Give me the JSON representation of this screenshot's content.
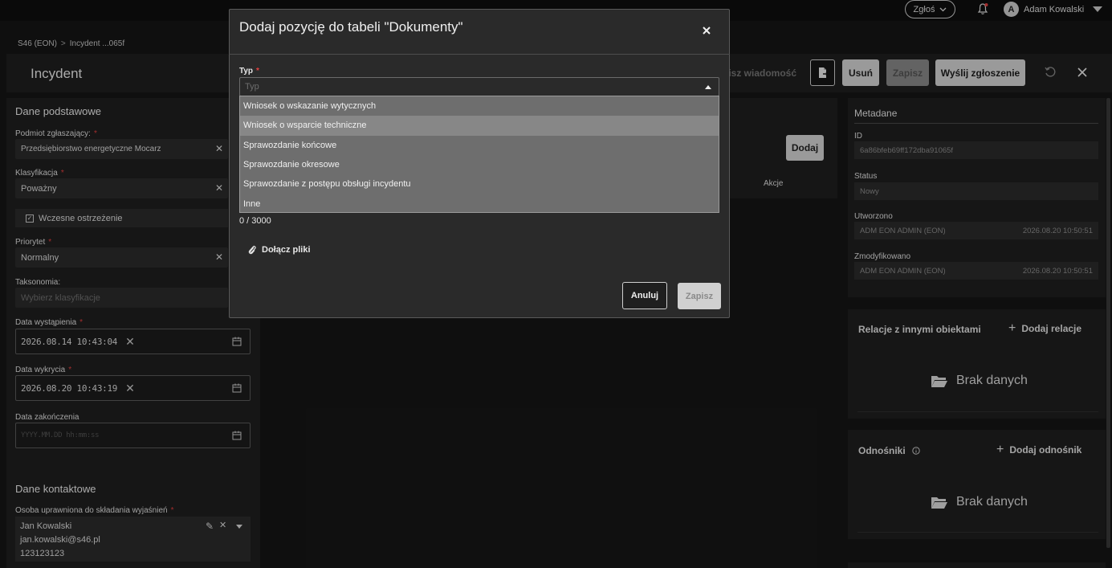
{
  "topbar": {
    "report_button": "Zgłoś",
    "user_initial": "A",
    "user_name": "Adam Kowalski"
  },
  "breadcrumb": {
    "root": "S46 (EON)",
    "separator": ">",
    "current": "Incydent ...065f"
  },
  "header": {
    "title": "Incydent",
    "partial_action": "pisz wiadomość",
    "delete_label": "Usuń",
    "save_label": "Zapisz",
    "send_label": "Wyślij zgłoszenie"
  },
  "basic": {
    "section_title": "Dane podstawowe",
    "reporter_label": "Podmiot zgłaszający:",
    "reporter_value": "Przedsiębiorstwo energetyczne Mocarz",
    "classification_label": "Klasyfikacja",
    "classification_value": "Poważny",
    "early_warning_label": "Wczesne ostrzeżenie",
    "priority_label": "Priorytet",
    "priority_value": "Normalny",
    "taxonomy_label": "Taksonomia:",
    "taxonomy_placeholder": "Wybierz klasyfikacje",
    "occurrence_label": "Data wystąpienia",
    "occurrence_value": "2026.08.14 10:43:04",
    "detection_label": "Data wykrycia",
    "detection_value": "2026.08.20 10:43:19",
    "end_label": "Data zakończenia",
    "end_placeholder": "YYYY.MM.DD hh:mm:ss"
  },
  "contact": {
    "section_title": "Dane kontaktowe",
    "person_label": "Osoba uprawniona do składania wyjaśnień",
    "name": "Jan Kowalski",
    "email": "jan.kowalski@s46.pl",
    "phone": "123123123"
  },
  "center": {
    "add_label": "Dodaj",
    "actions_header": "Akcje"
  },
  "metadata": {
    "title": "Metadane",
    "id_label": "ID",
    "id_value": "6a86bfeb69ff172dba91065f",
    "status_label": "Status",
    "status_value": "Nowy",
    "created_label": "Utworzono",
    "created_by": "ADM EON ADMIN (EON)",
    "created_at": "2026.08.20 10:50:51",
    "modified_label": "Zmodyfikowano",
    "modified_by": "ADM EON ADMIN (EON)",
    "modified_at": "2026.08.20 10:50:51"
  },
  "relations": {
    "title": "Relacje z innymi obiektami",
    "add_label": "Dodaj relacje",
    "empty_label": "Brak danych"
  },
  "links": {
    "title": "Odnośniki",
    "add_label": "Dodaj odnośnik",
    "empty_label": "Brak danych"
  },
  "modal": {
    "title": "Dodaj pozycję do tabeli \"Dokumenty\"",
    "type_label": "Typ",
    "type_placeholder": "Typ",
    "options": [
      "Wniosek o wskazanie wytycznych",
      "Wniosek o wsparcie techniczne",
      "Sprawozdanie końcowe",
      "Sprawozdanie okresowe",
      "Sprawozdanie z postępu obsługi incydentu",
      "Inne"
    ],
    "highlighted_option_index": 1,
    "char_counter": "0 / 3000",
    "attach_label": "Dołącz pliki",
    "cancel_label": "Anuluj",
    "save_label": "Zapisz"
  },
  "colors": {
    "background": "#161616",
    "panel": "#1f1f1f",
    "field": "#2c2c2c",
    "required": "#e34040",
    "button_light": "#d6d6d6",
    "dropdown": "#6e6e6e",
    "dropdown_highlight": "#878787"
  }
}
